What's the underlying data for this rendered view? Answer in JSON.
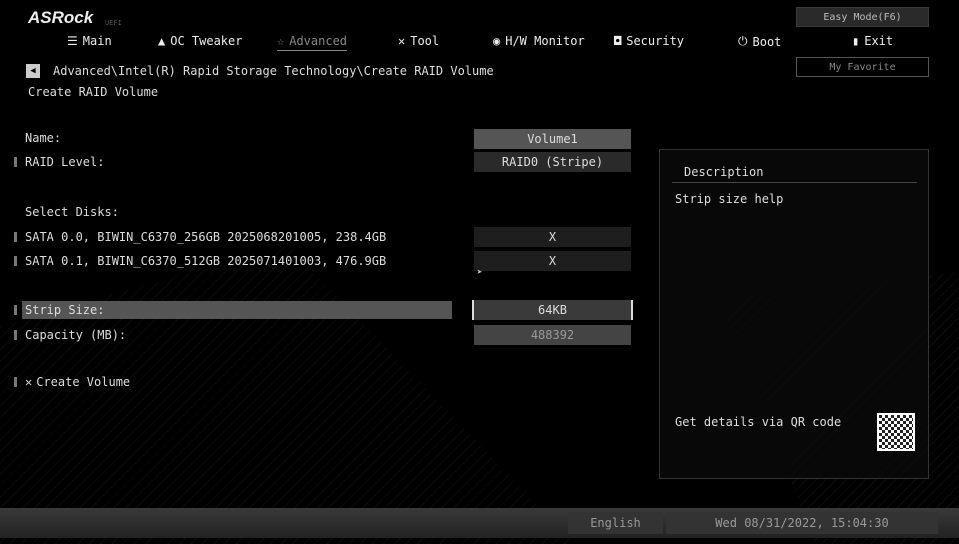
{
  "header": {
    "logo": "ASRock",
    "logo_sub": "UEFI",
    "easy_mode": "Easy Mode(F6)",
    "my_favorite": "My Favorite",
    "tabs": [
      {
        "label": "Main",
        "icon": "list-icon"
      },
      {
        "label": "OC Tweaker",
        "icon": "rocket-icon"
      },
      {
        "label": "Advanced",
        "icon": "star-icon"
      },
      {
        "label": "Tool",
        "icon": "tools-icon"
      },
      {
        "label": "H/W Monitor",
        "icon": "monitor-icon"
      },
      {
        "label": "Security",
        "icon": "shield-icon"
      },
      {
        "label": "Boot",
        "icon": "power-icon"
      },
      {
        "label": "Exit",
        "icon": "door-icon"
      }
    ]
  },
  "breadcrumb": "Advanced\\Intel(R) Rapid Storage Technology\\Create RAID Volume",
  "page_title": "Create RAID Volume",
  "fields": {
    "name_label": "Name:",
    "name_value": "Volume1",
    "raid_label": "RAID Level:",
    "raid_value": "RAID0 (Stripe)",
    "select_disks": "Select Disks:",
    "disk0": "SATA 0.0, BIWIN_C6370_256GB 2025068201005, 238.4GB",
    "disk0_value": "X",
    "disk1": "SATA 0.1, BIWIN_C6370_512GB 2025071401003, 476.9GB",
    "disk1_value": "X",
    "strip_label": "Strip Size:",
    "strip_value": "64KB",
    "capacity_label": "Capacity (MB):",
    "capacity_value": "488392",
    "create": "Create Volume"
  },
  "description": {
    "title": "Description",
    "text": "Strip size help",
    "qr_text": "Get details via QR code"
  },
  "footer": {
    "language": "English",
    "datetime": "Wed 08/31/2022, 15:04:30"
  }
}
